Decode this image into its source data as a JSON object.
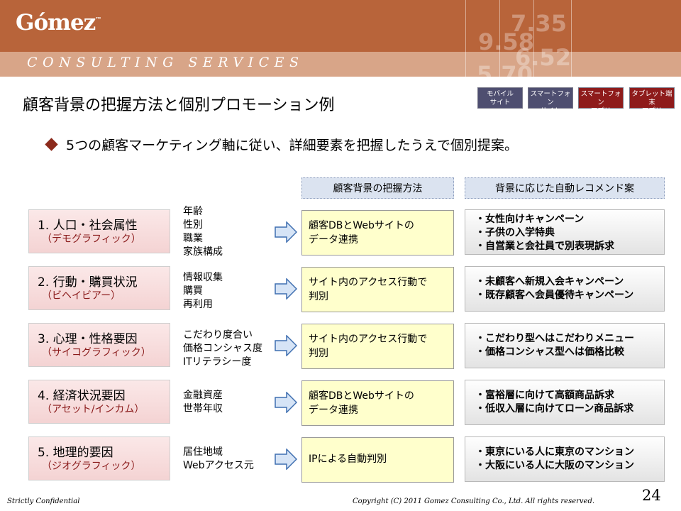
{
  "header": {
    "logo": "Gómez",
    "logo_tm": "™",
    "tagline": "CONSULTING SERVICES",
    "deco_numbers": [
      "7.35",
      "9.58",
      "6.52",
      "5.70"
    ]
  },
  "title": "顧客背景の把握方法と個別プロモーション例",
  "badges": [
    {
      "line1": "モバイル",
      "line2": "サイト"
    },
    {
      "line1": "スマートフォン",
      "line2": "サイト"
    },
    {
      "line1": "スマートフォン",
      "line2": "アプリ"
    },
    {
      "line1": "タブレット端末",
      "line2": "アプリ"
    }
  ],
  "lead": "5つの顧客マーケティング軸に従い、詳細要素を把握したうえで個別提案。",
  "columns": {
    "method_header": "顧客背景の把握方法",
    "rec_header": "背景に応じた自動レコメンド案"
  },
  "rows": [
    {
      "axis": "1. 人口・社会属性",
      "axis_sub": "（デモグラフィック）",
      "details": [
        "年齢",
        "性別",
        "職業",
        "家族構成"
      ],
      "method": [
        "顧客DBとWebサイトの",
        "データ連携"
      ],
      "recs": [
        "・女性向けキャンペーン",
        "・子供の入学特典",
        "・自営業と会社員で別表現訴求"
      ]
    },
    {
      "axis": "2. 行動・購買状況",
      "axis_sub": "（ビヘイビアー）",
      "details": [
        "情報収集",
        "購買",
        "再利用"
      ],
      "method": [
        "サイト内のアクセス行動で",
        "判別"
      ],
      "recs": [
        "・未顧客へ新規入会キャンペーン",
        "・既存顧客へ会員優待キャンペーン"
      ]
    },
    {
      "axis": "3. 心理・性格要因",
      "axis_sub": "（サイコグラフィック）",
      "details": [
        "こだわり度合い",
        "価格コンシャス度",
        "ITリテラシー度"
      ],
      "method": [
        "サイト内のアクセス行動で",
        "判別"
      ],
      "recs": [
        "・こだわり型へはこだわりメニュー",
        "・価格コンシャス型へは価格比較"
      ]
    },
    {
      "axis": "4. 経済状況要因",
      "axis_sub": "（アセット/インカム）",
      "details": [
        "金融資産",
        "世帯年収"
      ],
      "method": [
        "顧客DBとWebサイトの",
        "データ連携"
      ],
      "recs": [
        "・富裕層に向けて高額商品訴求",
        "・低収入層に向けてローン商品訴求"
      ]
    },
    {
      "axis": "5. 地理的要因",
      "axis_sub": "（ジオグラフィック）",
      "details": [
        "居住地域",
        "Webアクセス元"
      ],
      "method": [
        "IPによる自動判別"
      ],
      "recs": [
        "・東京にいる人に東京のマンション",
        "・大阪にいる人に大阪のマンション"
      ]
    }
  ],
  "footer": {
    "confidential": "Strictly Confidential",
    "copyright": "Copyright (C) 2011 Gomez Consulting Co., Ltd.  All rights reserved.",
    "page": "24"
  },
  "colors": {
    "header_dark": "#b8643a",
    "header_light": "#d8a588",
    "badge_blue": "#4e4e70",
    "badge_red": "#8e1b1b",
    "method_fill": "#ffffcc",
    "column_header_fill": "#dbe3f0",
    "arrow_fill": "#d6e4f6"
  }
}
